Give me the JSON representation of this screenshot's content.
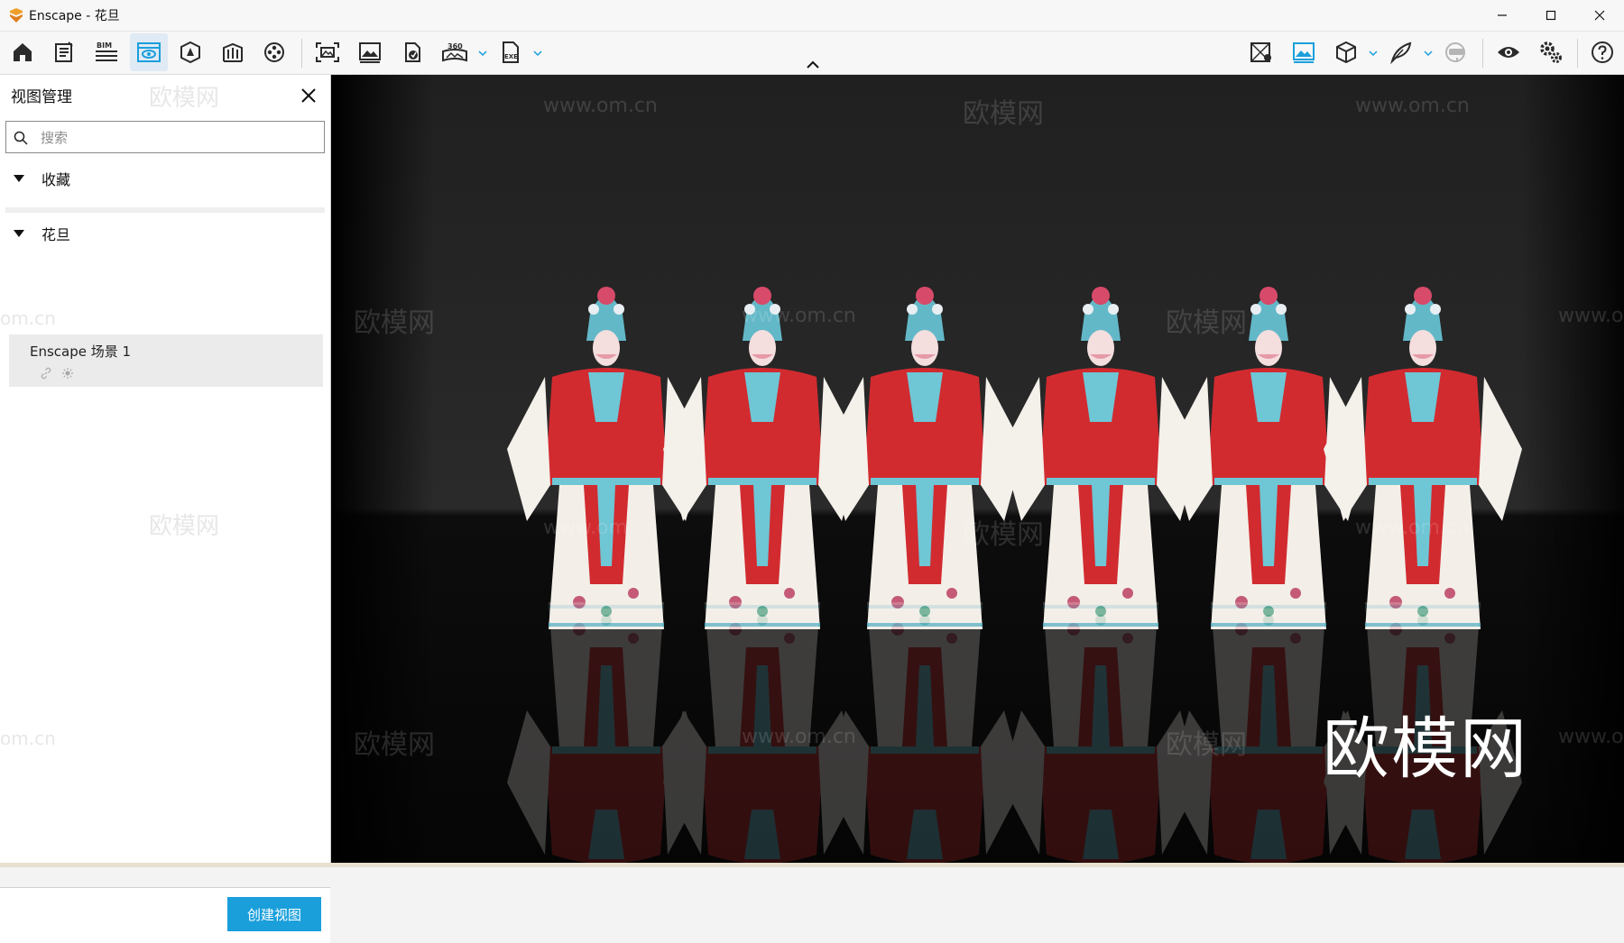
{
  "window": {
    "title": "Enscape - 花旦",
    "app_logo": "enscape-logo",
    "controls": [
      "minimize-icon",
      "maximize-icon",
      "close-icon"
    ]
  },
  "toolbar": {
    "left_icons": [
      "home-icon",
      "notes-icon",
      "bim-icon",
      "view-management-icon",
      "asset-library-icon",
      "materials-icon",
      "video-editor-icon",
      "screenshot-icon",
      "image-icon",
      "batch-render-icon",
      "panorama-360-icon",
      "exe-export-icon"
    ],
    "bim_label": "BIM",
    "pano_label": "360",
    "exe_label": "EXE",
    "right_icons": [
      "map-icon",
      "image-settings-icon",
      "cube-icon",
      "feather-icon",
      "vr-headset-icon",
      "eye-icon",
      "settings-icon",
      "help-icon"
    ]
  },
  "sidebar": {
    "title": "视图管理",
    "search_placeholder": "搜索",
    "groups": [
      {
        "label": "收藏"
      },
      {
        "label": "花旦"
      }
    ],
    "view_item": {
      "name": "Enscape 场景 1"
    },
    "create_button": "创建视图"
  },
  "viewport": {
    "brand_text": "欧模网",
    "watermark_site": "www.om.cn",
    "watermark_brand": "欧模网",
    "watermark_partial": "om.cn",
    "watermark_partial2": "www.o",
    "scene": "six Peking opera Huadan performers in red and white costumes on a dark reflective stage",
    "colors": {
      "costume_red": "#d02a2e",
      "sash_blue": "#5bbcd0",
      "skirt_white": "#f3efe8"
    }
  },
  "colors": {
    "accent": "#1a9fdb",
    "active_tool_bg": "#dfeaf5",
    "icon_blue": "#1a9fdb"
  }
}
